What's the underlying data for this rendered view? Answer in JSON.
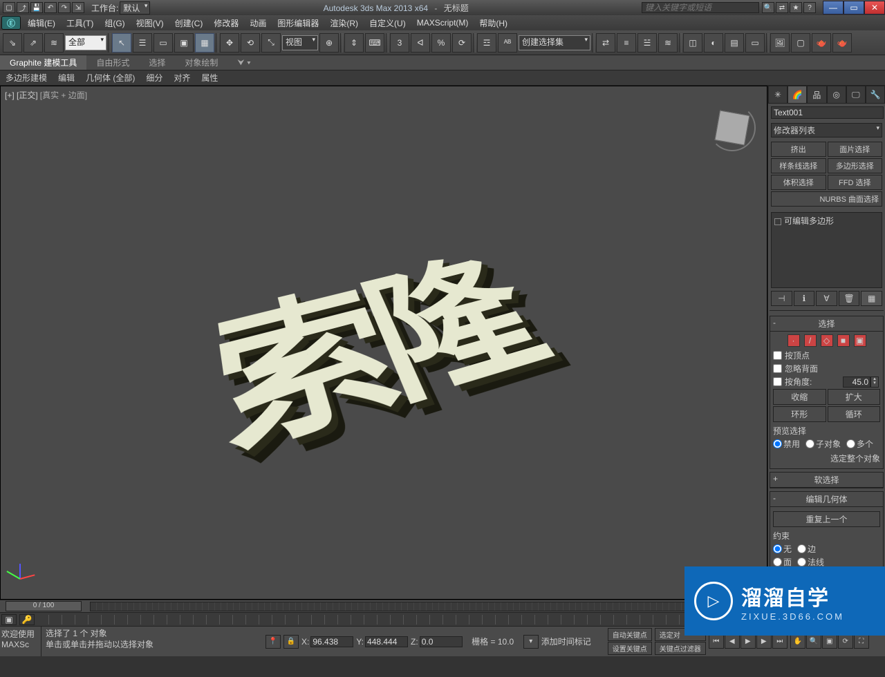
{
  "titlebar": {
    "workspace_label": "工作台:",
    "workspace_value": "默认",
    "app": "Autodesk 3ds Max  2013 x64",
    "dash": "-",
    "filename": "无标题",
    "search_placeholder": "键入关键字或短语"
  },
  "menus": {
    "edit": "编辑(E)",
    "tools": "工具(T)",
    "group": "组(G)",
    "views": "视图(V)",
    "create": "创建(C)",
    "modifiers": "修改器",
    "animation": "动画",
    "graph": "图形编辑器",
    "rendering": "渲染(R)",
    "customize": "自定义(U)",
    "maxscript": "MAXScript(M)",
    "help": "帮助(H)"
  },
  "toolbar": {
    "filter_dd": "全部",
    "view_dd": "视图",
    "named_sel": "创建选择集"
  },
  "ribbon": {
    "graphite": "Graphite 建模工具",
    "freeform": "自由形式",
    "selection": "选择",
    "paint": "对象绘制",
    "sub": {
      "polymodel": "多边形建模",
      "edit": "编辑",
      "geom_all": "几何体 (全部)",
      "subdiv": "细分",
      "align": "对齐",
      "props": "属性"
    }
  },
  "viewport": {
    "label_prefix": "[+] [正交]",
    "shading": "[真实 + 边面]",
    "text3d": "索隆"
  },
  "cmdpanel": {
    "objname": "Text001",
    "modlist_placeholder": "修改器列表",
    "sel": {
      "extrude": "挤出",
      "face_sel": "面片选择",
      "spline_sel": "样条线选择",
      "poly_sel": "多边形选择",
      "vol_sel": "体积选择",
      "ffd_sel": "FFD 选择",
      "nurbs_sel": "NURBS 曲面选择"
    },
    "stack": {
      "item0": "可编辑多边形"
    },
    "roll_sel": {
      "title": "选择",
      "by_vertex": "按顶点",
      "ignore_back": "忽略背面",
      "by_angle": "按角度:",
      "angle_val": "45.0",
      "shrink": "收缩",
      "grow": "扩大",
      "ring": "环形",
      "loop": "循环",
      "preview_sel": "预览选择",
      "off": "禁用",
      "subobj": "子对象",
      "multi": "多个",
      "whole": "选定整个对象"
    },
    "roll_soft": {
      "title": "软选择"
    },
    "roll_editgeo": {
      "title": "编辑几何体",
      "repeat_last": "重复上一个",
      "constraint": "约束",
      "none": "无",
      "edge": "边",
      "face": "面",
      "normal": "法线"
    }
  },
  "watermark": {
    "cn": "溜溜自学",
    "en": "ZIXUE.3D66.COM"
  },
  "timeline": {
    "slider": "0 / 100"
  },
  "status": {
    "welcome": "欢迎使用  MAXSc",
    "msg1": "选择了 1 个 对象",
    "msg2": "单击或单击并拖动以选择对象",
    "x_label": "X:",
    "x_val": "96.438",
    "y_label": "Y:",
    "y_val": "448.444",
    "z_label": "Z:",
    "z_val": "0.0",
    "grid": "栅格 = 10.0",
    "add_time_tag": "添加时间标记",
    "auto_key": "自动关键点",
    "set_key": "设置关键点",
    "sel_pair": "选定对",
    "key_filter": "关键点过滤器"
  }
}
